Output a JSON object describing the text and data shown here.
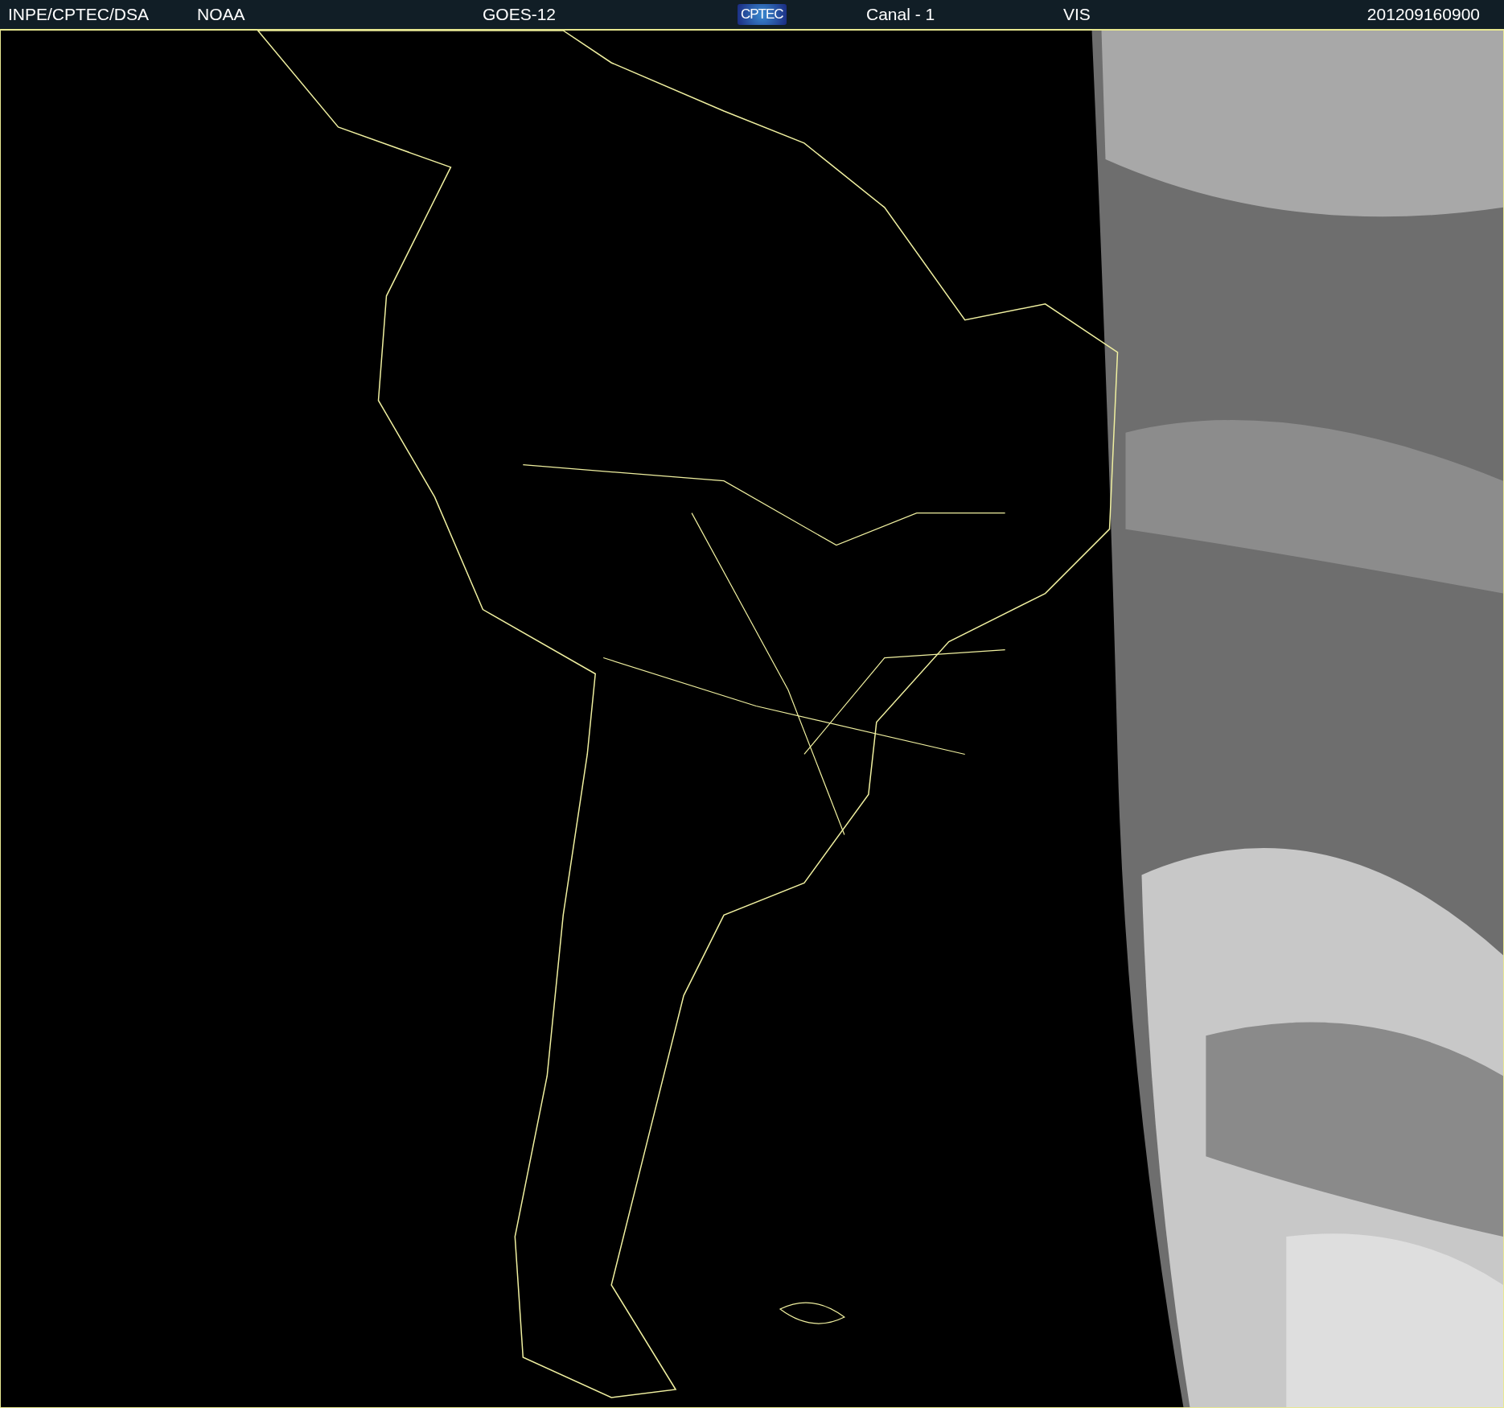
{
  "header": {
    "items": [
      {
        "kind": "text",
        "text": "INPE/CPTEC/DSA"
      },
      {
        "kind": "text",
        "text": "NOAA"
      },
      {
        "kind": "text",
        "text": "GOES-12"
      },
      {
        "kind": "logo",
        "text": "CPTEC"
      },
      {
        "kind": "text",
        "text": "Canal - 1"
      },
      {
        "kind": "text",
        "text": "VIS"
      },
      {
        "kind": "text",
        "text": "201209160900"
      }
    ]
  }
}
